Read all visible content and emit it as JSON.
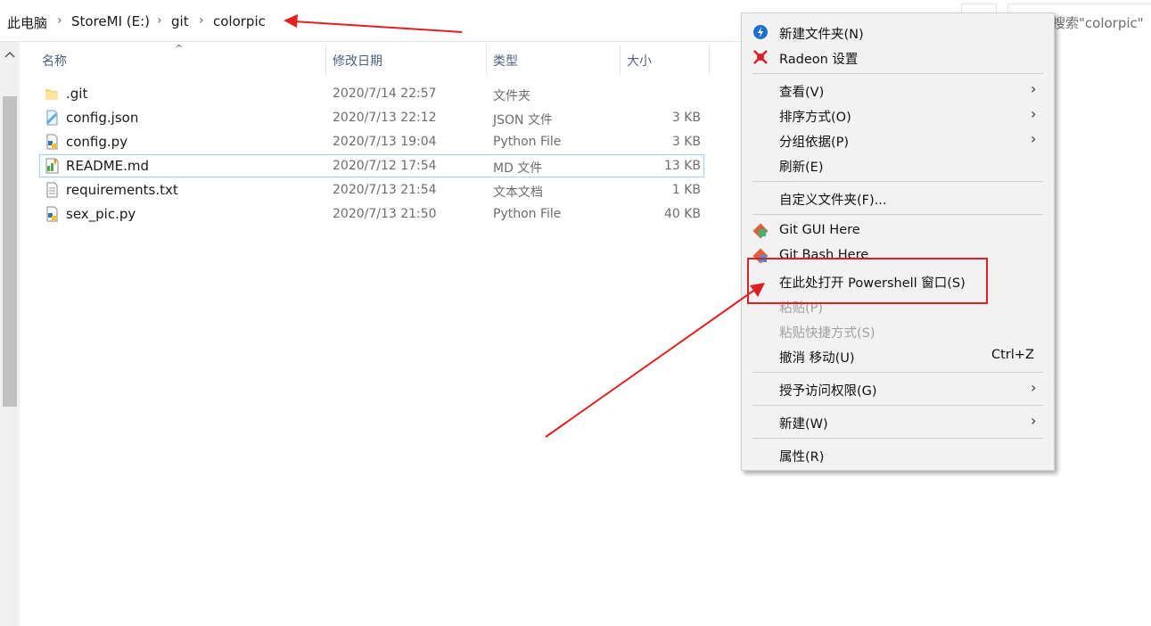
{
  "breadcrumb": [
    "此电脑",
    "StoreMI (E:)",
    "git",
    "colorpic"
  ],
  "search": {
    "placeholder": "搜索\"colorpic\""
  },
  "columns": {
    "name": "名称",
    "date": "修改日期",
    "type": "类型",
    "size": "大小"
  },
  "files": [
    {
      "name": ".git",
      "date": "2020/7/14 22:57",
      "type": "文件夹",
      "size": "",
      "icon": "folder-icon"
    },
    {
      "name": "config.json",
      "date": "2020/7/13 22:12",
      "type": "JSON 文件",
      "size": "3 KB",
      "icon": "json-file-icon"
    },
    {
      "name": "config.py",
      "date": "2020/7/13 19:04",
      "type": "Python File",
      "size": "3 KB",
      "icon": "python-file-icon"
    },
    {
      "name": "README.md",
      "date": "2020/7/12 17:54",
      "type": "MD 文件",
      "size": "13 KB",
      "icon": "markdown-file-icon"
    },
    {
      "name": "requirements.txt",
      "date": "2020/7/13 21:54",
      "type": "文本文档",
      "size": "1 KB",
      "icon": "text-file-icon"
    },
    {
      "name": "sex_pic.py",
      "date": "2020/7/13 21:50",
      "type": "Python File",
      "size": "40 KB",
      "icon": "python-file-icon"
    }
  ],
  "context_menu": {
    "new_folder": "新建文件夹(N)",
    "radeon": "Radeon 设置",
    "view": "查看(V)",
    "sort": "排序方式(O)",
    "group": "分组依据(P)",
    "refresh": "刷新(E)",
    "customize": "自定义文件夹(F)...",
    "git_gui": "Git GUI Here",
    "git_bash": "Git Bash Here",
    "powershell": "在此处打开 Powershell 窗口(S)",
    "paste": "粘贴(P)",
    "paste_shortcut": "粘贴快捷方式(S)",
    "undo": "撤消 移动(U)",
    "undo_shortcut": "Ctrl+Z",
    "grant_access": "授予访问权限(G)",
    "new": "新建(W)",
    "properties": "属性(R)"
  },
  "colors": {
    "annotation": "#e02020",
    "selection_border": "#99d1ff",
    "header_text": "#4d6082"
  }
}
